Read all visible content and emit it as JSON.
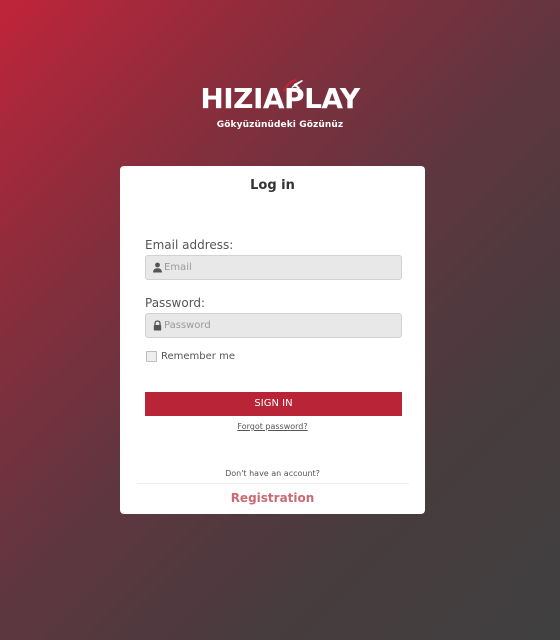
{
  "brand": {
    "logo_text": "HIZIAPLAY",
    "tagline": "Gökyüzünüdeki Gözünüz"
  },
  "login": {
    "title": "Log in",
    "email_label": "Email address:",
    "email_placeholder": "Email",
    "password_label": "Password:",
    "password_placeholder": "Password",
    "remember_label": "Remember me",
    "signin_label": "SIGN IN",
    "forgot_label": "Forgot  password?",
    "no_account_label": "Don't have an account?",
    "register_label": "Registration"
  },
  "colors": {
    "accent": "#b92537",
    "register_link": "#c96a74",
    "gradient_start": "#c0243a",
    "gradient_end": "#404040"
  },
  "icons": {
    "email": "user-icon",
    "password": "lock-icon",
    "logo": "airplane-icon"
  }
}
